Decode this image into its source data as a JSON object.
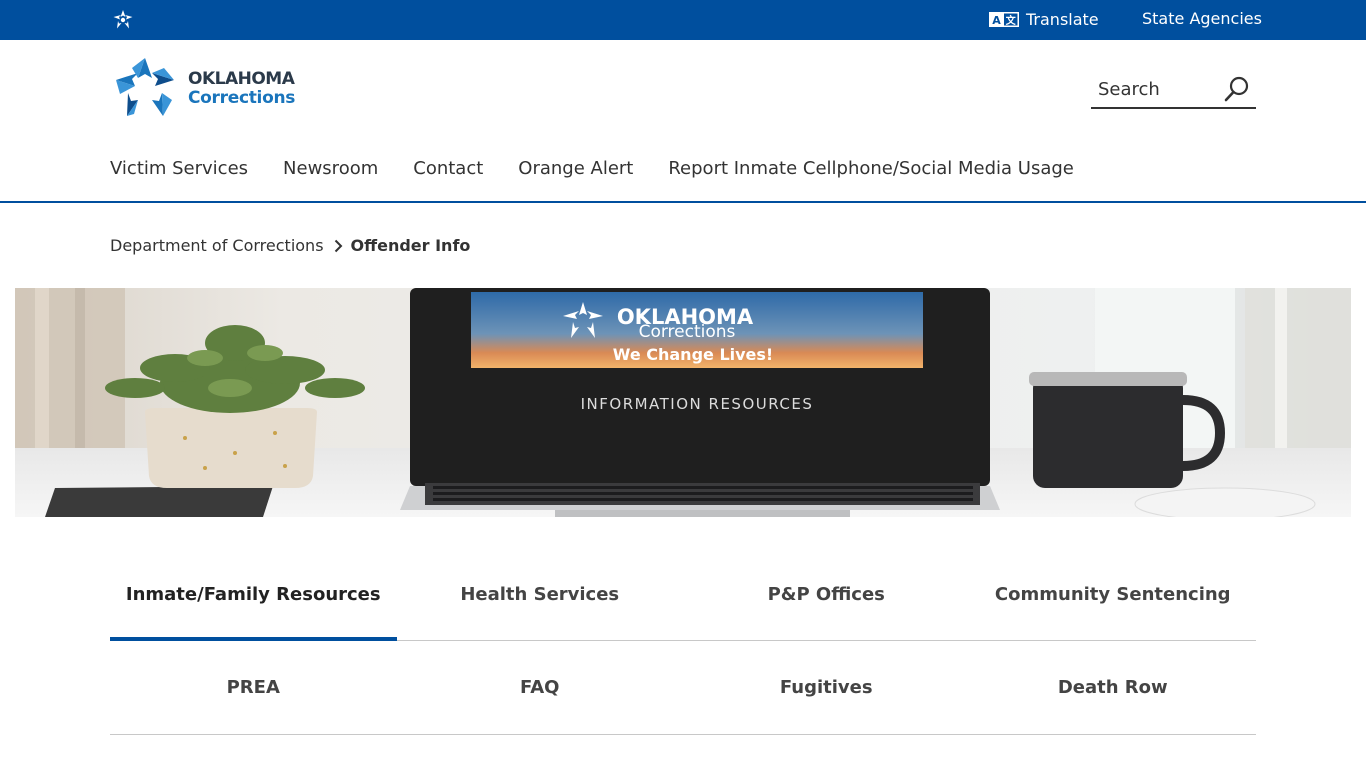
{
  "topbar": {
    "translate_label": "Translate",
    "state_agencies_label": "State Agencies",
    "bg_color": "#004f9e"
  },
  "logo": {
    "line1": "OKLAHOMA",
    "line2": "Corrections"
  },
  "search": {
    "placeholder": "Search"
  },
  "nav": {
    "items": [
      {
        "label": "Victim Services"
      },
      {
        "label": "Newsroom"
      },
      {
        "label": "Contact"
      },
      {
        "label": "Orange Alert"
      },
      {
        "label": "Report Inmate Cellphone/Social Media Usage"
      }
    ]
  },
  "breadcrumb": {
    "parent": "Department of Corrections",
    "separator": "›",
    "current": "Offender Info"
  },
  "hero": {
    "screen_line1": "OKLAHOMA",
    "screen_line2": "Corrections",
    "screen_tagline": "We Change Lives!",
    "screen_caption": "INFORMATION RESOURCES"
  },
  "tabs": {
    "row1": [
      {
        "label": "Inmate/Family Resources",
        "active": true
      },
      {
        "label": "Health Services",
        "active": false
      },
      {
        "label": "P&P Offices",
        "active": false
      },
      {
        "label": "Community Sentencing",
        "active": false
      }
    ],
    "row2": [
      {
        "label": "PREA"
      },
      {
        "label": "FAQ"
      },
      {
        "label": "Fugitives"
      },
      {
        "label": "Death Row"
      }
    ]
  }
}
